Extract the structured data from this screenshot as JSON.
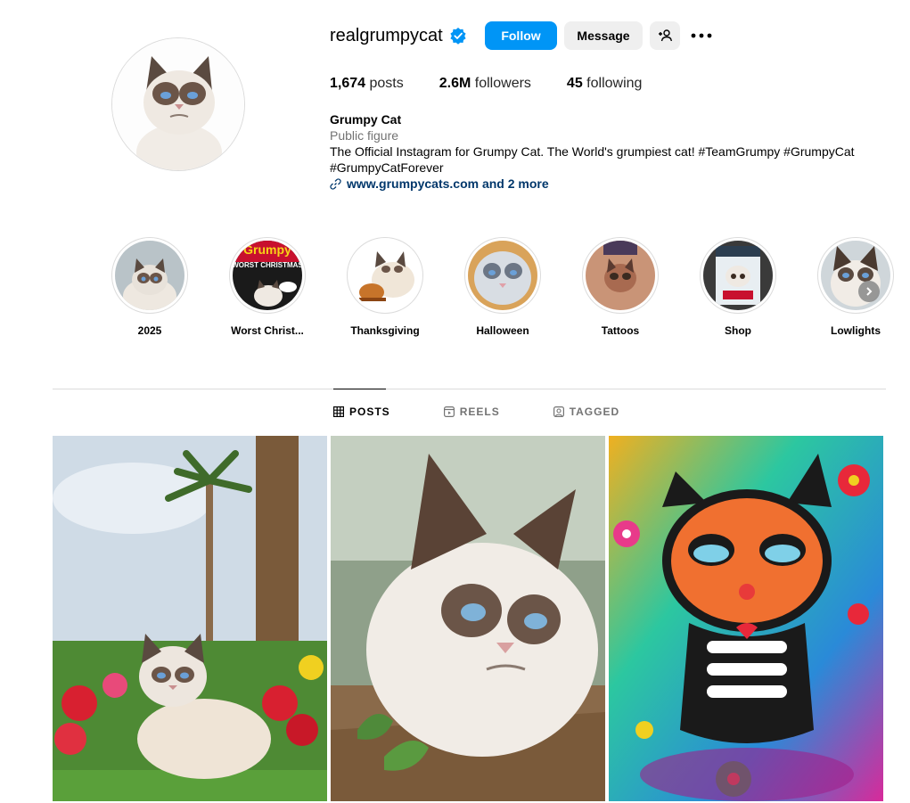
{
  "profile": {
    "username": "realgrumpycat",
    "verified": true,
    "follow_label": "Follow",
    "message_label": "Message",
    "stats": {
      "posts_count": "1,674",
      "posts_label": "posts",
      "followers_count": "2.6M",
      "followers_label": "followers",
      "following_count": "45",
      "following_label": "following"
    },
    "full_name": "Grumpy Cat",
    "category": "Public figure",
    "bio_line1": "The Official Instagram for Grumpy Cat. The World's grumpiest cat! #TeamGrumpy #GrumpyCat",
    "bio_line2": "#GrumpyCatForever",
    "link": "www.grumpycats.com and 2 more"
  },
  "highlights": [
    {
      "label": "2025"
    },
    {
      "label": "Worst Christ..."
    },
    {
      "label": "Thanksgiving"
    },
    {
      "label": "Halloween"
    },
    {
      "label": "Tattoos"
    },
    {
      "label": "Shop"
    },
    {
      "label": "Lowlights"
    }
  ],
  "tabs": [
    {
      "label": "POSTS",
      "active": true,
      "icon": "grid-icon"
    },
    {
      "label": "REELS",
      "active": false,
      "icon": "reels-icon"
    },
    {
      "label": "TAGGED",
      "active": false,
      "icon": "tagged-icon"
    }
  ],
  "highlight_text": {
    "worst_christmas_brand": "Grumpy",
    "worst_christmas_title": "WORST CHRISTMAS"
  },
  "colors": {
    "accent": "#0095f6",
    "link": "#00376b",
    "secondary_text": "#737373",
    "button_bg": "#efefef"
  }
}
